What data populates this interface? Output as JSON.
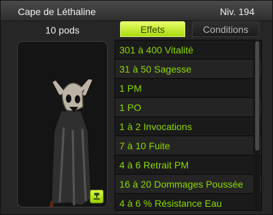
{
  "title_bar": {
    "item_name": "Cape de Léthaline",
    "level": "Niv. 194"
  },
  "item": {
    "weight": "10 pods",
    "icons": {
      "picture": "cape-icon",
      "set": "set-bonus-icon"
    }
  },
  "tabs": {
    "effects": "Effets",
    "conditions": "Conditions",
    "active": "effects"
  },
  "effects": [
    "301 à 400 Vitalité",
    "31 à 50 Sagesse",
    "1 PM",
    "1 PO",
    "1 à 2 Invocations",
    "7 à 10 Fuite",
    "4 à 6 Retrait PM",
    "16 à 20 Dommages Poussée",
    "4 à 6 % Résistance Eau"
  ],
  "colors": {
    "accent": "#a9d90d",
    "effect_text": "#8bd900",
    "panel_bg": "#262626"
  }
}
